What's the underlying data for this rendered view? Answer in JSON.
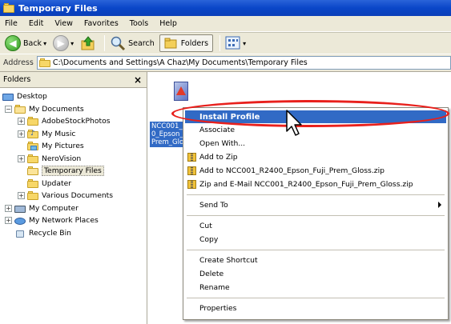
{
  "window": {
    "title": "Temporary Files"
  },
  "menu": [
    "File",
    "Edit",
    "View",
    "Favorites",
    "Tools",
    "Help"
  ],
  "toolbar": {
    "back_label": "Back",
    "search_label": "Search",
    "folders_label": "Folders"
  },
  "address": {
    "label": "Address",
    "path": "C:\\Documents and Settings\\A Chaz\\My Documents\\Temporary Files"
  },
  "folders_pane": {
    "title": "Folders",
    "close": "×",
    "items": [
      {
        "label": "Desktop",
        "icon": "desktop-icon"
      },
      {
        "label": "My Documents",
        "icon": "folder-open-icon"
      },
      {
        "label": "AdobeStockPhotos",
        "icon": "folder-icon"
      },
      {
        "label": "My Music",
        "icon": "music-folder-icon"
      },
      {
        "label": "My Pictures",
        "icon": "pictures-folder-icon"
      },
      {
        "label": "NeroVision",
        "icon": "folder-icon"
      },
      {
        "label": "Temporary Files",
        "icon": "folder-open-icon"
      },
      {
        "label": "Updater",
        "icon": "folder-icon"
      },
      {
        "label": "Various Documents",
        "icon": "folder-icon"
      },
      {
        "label": "My Computer",
        "icon": "computer-icon"
      },
      {
        "label": "My Network Places",
        "icon": "network-icon"
      },
      {
        "label": "Recycle Bin",
        "icon": "recycle-bin-icon"
      }
    ]
  },
  "file": {
    "label_lines": [
      "NCC001_R240",
      "0_Epson_Fuji_",
      "Prem_Gloss"
    ]
  },
  "context_menu": {
    "install": "Install Profile",
    "associate": "Associate",
    "open_with": "Open With...",
    "add_zip": "Add to Zip",
    "add_named_zip": "Add to NCC001_R2400_Epson_Fuji_Prem_Gloss.zip",
    "zip_email": "Zip and E-Mail NCC001_R2400_Epson_Fuji_Prem_Gloss.zip",
    "send_to": "Send To",
    "cut": "Cut",
    "copy": "Copy",
    "create_shortcut": "Create Shortcut",
    "delete": "Delete",
    "rename": "Rename",
    "properties": "Properties"
  },
  "colors": {
    "title_blue": "#0a46c8",
    "highlight": "#316ac5",
    "annotation_red": "#e8201c"
  }
}
